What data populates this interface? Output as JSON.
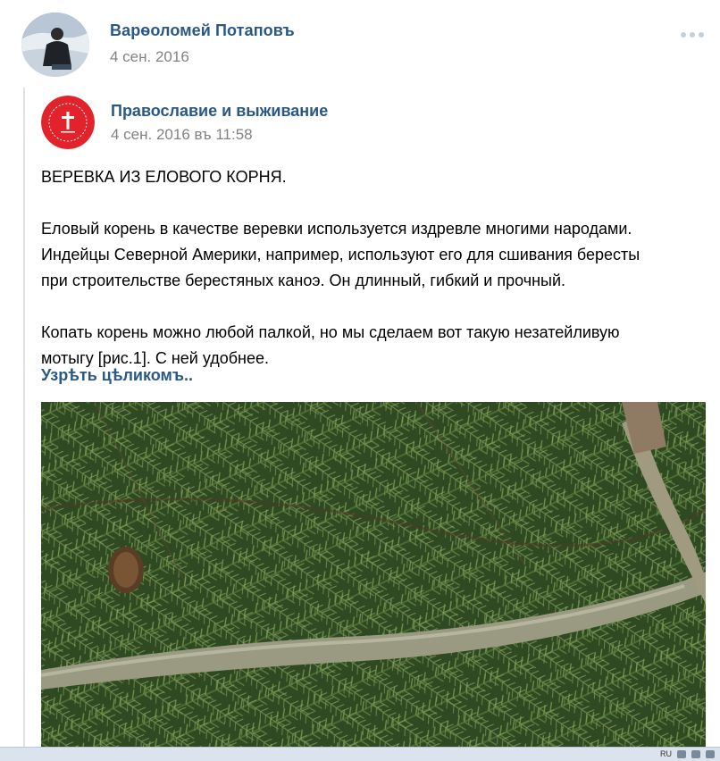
{
  "post": {
    "author_name": "Варѳоломей Потаповъ",
    "date": "4 сен. 2016",
    "more_icon": "more-dots-icon"
  },
  "repost": {
    "group_name": "Православие и выживание",
    "date": "4 сен. 2016 въ 11:58",
    "title": "ВЕРЕВКА ИЗ ЕЛОВОГО КОРНЯ.",
    "paragraph1_line1": "Еловый корень в качестве веревки используется издревле многими народами.",
    "paragraph1_line2": "Индейцы Северной Америки, например, используют его для сшивания бересты",
    "paragraph1_line3": "при строительстве берестяных каноэ. Он длинный, гибкий и прочный.",
    "paragraph2_line1": "Копать корень можно любой палкой, но мы сделаем вот такую незатейливую",
    "paragraph2_line2": "мотыгу [рис.1]. С ней удобнее.",
    "expand_label": "Узрѣть цѣликомъ.."
  },
  "taskbar": {
    "language": "RU"
  },
  "colors": {
    "link": "#2a5885",
    "muted": "#828282",
    "group_avatar_bg": "#e3232c"
  }
}
